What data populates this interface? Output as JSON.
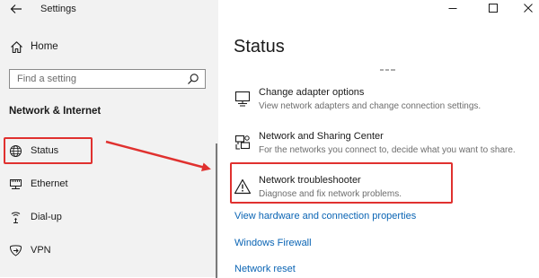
{
  "window": {
    "title": "Settings",
    "controls": [
      "minimize-icon",
      "maximize-icon",
      "close-icon"
    ]
  },
  "sidebar": {
    "home_label": "Home",
    "search": {
      "placeholder": "Find a setting"
    },
    "section_heading": "Network & Internet",
    "items": [
      {
        "label": "Status",
        "icon": "globe-icon",
        "selected": true
      },
      {
        "label": "Ethernet",
        "icon": "ethernet-icon"
      },
      {
        "label": "Dial-up",
        "icon": "dialup-icon"
      },
      {
        "label": "VPN",
        "icon": "vpn-icon"
      }
    ]
  },
  "main": {
    "title": "Status",
    "options": [
      {
        "title": "Change adapter options",
        "description": "View network adapters and change connection settings.",
        "icon": "adapter-icon"
      },
      {
        "title": "Network and Sharing Center",
        "description": "For the networks you connect to, decide what you want to share.",
        "icon": "sharing-center-icon"
      },
      {
        "title": "Network troubleshooter",
        "description": "Diagnose and fix network problems.",
        "icon": "warning-icon"
      }
    ],
    "links": [
      "View hardware and connection properties",
      "Windows Firewall",
      "Network reset"
    ]
  },
  "annotation": {
    "highlight_color": "#e0312f",
    "link_color": "#0a64b4"
  }
}
